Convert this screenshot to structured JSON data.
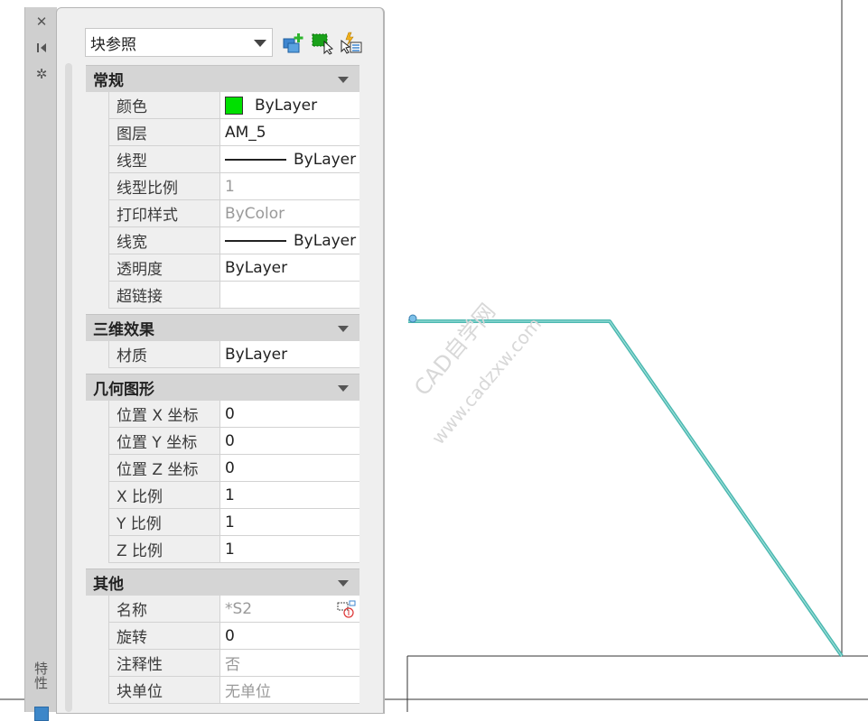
{
  "palette": {
    "label": "特性",
    "strip_icons": [
      "close-icon",
      "auto-hide-icon",
      "settings-icon"
    ]
  },
  "selector": {
    "value": "块参照"
  },
  "toolbar_icons": [
    "toggle-pickadd-icon",
    "select-objects-icon",
    "quick-select-icon"
  ],
  "sections": {
    "general": {
      "title": "常规",
      "rows": {
        "color": {
          "name": "颜色",
          "value": "ByLayer",
          "swatch": "#00e000"
        },
        "layer": {
          "name": "图层",
          "value": "AM_5"
        },
        "linetype": {
          "name": "线型",
          "value": "ByLayer"
        },
        "ltscale": {
          "name": "线型比例",
          "value": "1"
        },
        "plotstyle": {
          "name": "打印样式",
          "value": "ByColor"
        },
        "lineweight": {
          "name": "线宽",
          "value": "ByLayer"
        },
        "transparency": {
          "name": "透明度",
          "value": "ByLayer"
        },
        "hyperlink": {
          "name": "超链接",
          "value": ""
        }
      }
    },
    "threed": {
      "title": "三维效果",
      "rows": {
        "material": {
          "name": "材质",
          "value": "ByLayer"
        }
      }
    },
    "geometry": {
      "title": "几何图形",
      "rows": {
        "posx": {
          "name": "位置 X 坐标",
          "value": "0"
        },
        "posy": {
          "name": "位置 Y 坐标",
          "value": "0"
        },
        "posz": {
          "name": "位置 Z 坐标",
          "value": "0"
        },
        "scalex": {
          "name": "X 比例",
          "value": "1"
        },
        "scaley": {
          "name": "Y 比例",
          "value": "1"
        },
        "scalez": {
          "name": "Z 比例",
          "value": "1"
        }
      }
    },
    "misc": {
      "title": "其他",
      "rows": {
        "name": {
          "name": "名称",
          "value": "*S2"
        },
        "rotation": {
          "name": "旋转",
          "value": "0"
        },
        "annotative": {
          "name": "注释性",
          "value": "否"
        },
        "blockunit": {
          "name": "块单位",
          "value": "无单位"
        }
      }
    }
  },
  "watermark": {
    "line1": "CAD自学网",
    "line2": "www.cadzxw.com"
  },
  "colors": {
    "selected_polyline": "#4bb8b0",
    "swatch_green": "#00e000"
  }
}
